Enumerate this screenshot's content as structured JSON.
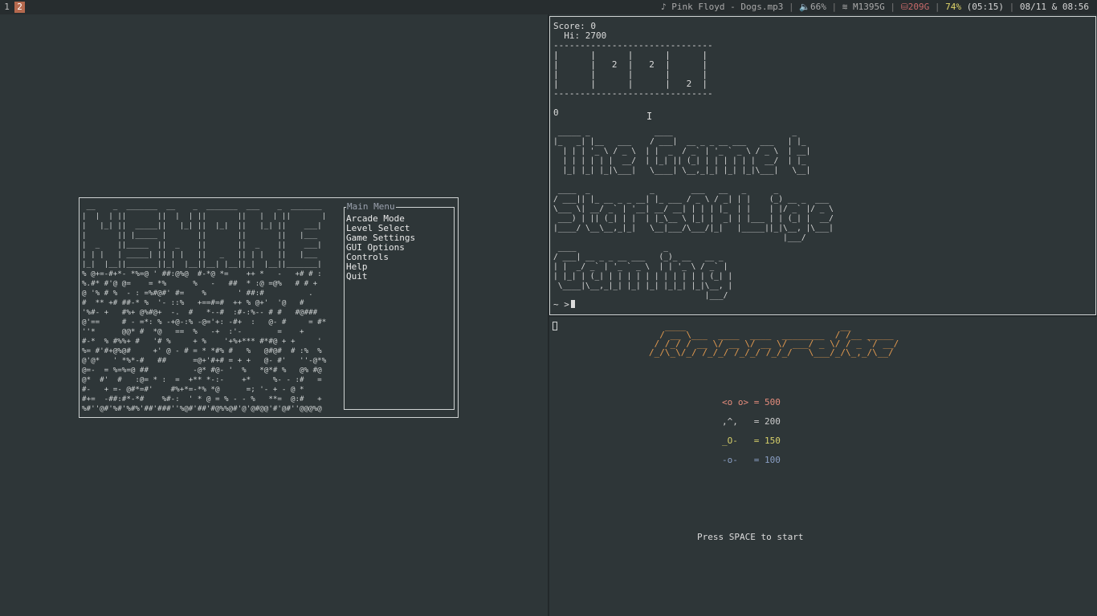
{
  "bar": {
    "workspaces": [
      "1",
      "2"
    ],
    "music_icon": "♪",
    "music": "Pink Floyd - Dogs.mp3",
    "volume_icon": "speaker-icon",
    "volume": "66%",
    "wifi_icon": "wifi-icon",
    "wifi": "M1395G",
    "disk_icon": "disk-icon",
    "disk": "209G",
    "battery": "74%",
    "battery_time": "(05:15)",
    "datetime": "08/11 & 08:56"
  },
  "menu": {
    "title_art": " __    _  _______  __    _  _______  ___    _  _______\n|  |  | ||       ||  |  | ||       ||   |  | ||       |\n|   |_| ||  _____||   |_| ||  |_|  ||   |_| ||    ___|\n|       || |_____ |       ||       ||       ||   |___ \n|  _    ||_____  ||  _    ||       ||  _    ||    ___|\n| | |   | _____| || | |   ||   _   || | |   ||   |___ \n|_|  |__||_______||_|  |__||__| |__||_|  |__||_______|",
    "noise": "% @+=-#+*- *%=@ ' ##:@%@  #-*@ *=    ++ *   -   +# # :\n%.#* #'@ @=    = *%      %   -   ##  * :@ =@%   # # +\n@ '% # %  - : =%#@#' #=    %       ' ##:#          .\n#  ** +# ##-* %  '- ::%   +==#=#  ++ % @+'  '@   #  \n'%#- +   #%+ @%#@+  -.  #   *--#  :#-:%-- # #   #@###\n@'==     # - =*: % -+@-:% -@='+: -#+  :   @- #     = #*\n''*      @@* #  *@   ==  %   -+  :'-        =    +   \n#-*  % #%%+ #   '# %     + %    '+%+*** #*#@ + +     '\n%= #'#+@%@#     +' @ - # = * *#% #   %   @#@#  # :%  %\n@'@*   ' *%*-#   ##      =@+'#+# = + +   @- #'   ''-@*%\n@=-  = %=%=@ ##          -@* #@- '  %   *@*# %   @% #@\n@*  #'  #   :@= * :  =  +** *-:-    +*     %- - :#   =\n#-   + =- @#*=#'    #%+*=-*% *@      =; '- + - @ *    \n#+=  -##:#*-*#    %#-:  ' * @ = % - - %   **=  @:#   +\n%#''@#'%#'%#%'##'###''%@#'##'#@%%@#'@'@#@@'#'@#''@@@%@",
    "box_title": "Main Menu",
    "items": [
      "Arcade Mode",
      "Level Select",
      "Game Settings",
      "GUI Options",
      "Controls",
      "Help",
      "Quit"
    ]
  },
  "terminal": {
    "score_label": "Score: 0",
    "hi_label": "  Hi: 2700",
    "grid": "------------------------------\n|      |      |      |      |\n|      |   2  |   2  |      |\n|      |      |      |      |\n|      |      |      |   2  |\n------------------------------",
    "zero": "0",
    "art": " _____ _              ____                          _      \n|_   _| |__   ___    / ___|  __ _ _ __ ___   ___   | |_   \n  | | | '_ \\ / _ \\  | |  _  / _` | '_ ` _ \\ / _ \\  | __|  \n  | | | | | |  __/  | |_| || (_| | | | | | |  __/  | |_   \n  |_| |_| |_|\\___|   \\____| \\__,_|_| |_| |_|\\___|   \\__|  \n\n ____  _             _        ___   __   _      _        \n/ ___|| |_ __ _ _ __| |_ ___ / _ \\ / _| | |    (_) __ _  ___ \n\\___ \\| __/ _` | '__| __/ __| | | | |_  | |    | |/ _` |/ _ \\\n ___) | || (_| | |  | |_\\__ \\ |_| |  _| | |___ | | (_| |  __/\n|____/ \\__\\__,_|_|   \\__|___/\\___/|_|   |_____||_|\\__, |\\___|\n                                                  |___/      \n ____                   _                         \n/ ___| __ _ _ __ ___   (_)_ __   __ _            \n| |  _/ _` | '_ ` _ \\  | | '_ \\ / _` |           \n| |_| | (_| | | | | | | | | | | | (_| |           \n \\____|\\__,_|_| |_| |_| |_|_| |_|\\__, |           \n                                 |___/            ",
    "prompt": "~ >"
  },
  "game": {
    "logo": "   ____                             __  \n  / __ \\___  ____  ____  ________  / /__ _____\n / /_/ / __ \\/ __ \\/ __ \\/ ___/ _ \\/ / _ `/ __/\n/_/\\_\\/_/ /_/_/ /_/_/ /_/_/   \\___/_/\\_,_/\\__/ ",
    "points": [
      {
        "glyph": "<o o>",
        "value": "= 500"
      },
      {
        "glyph": ",^,  ",
        "value": "= 200"
      },
      {
        "glyph": "_O-  ",
        "value": "= 150"
      },
      {
        "glyph": "-o-  ",
        "value": "= 100"
      }
    ],
    "press": "Press SPACE to start"
  }
}
